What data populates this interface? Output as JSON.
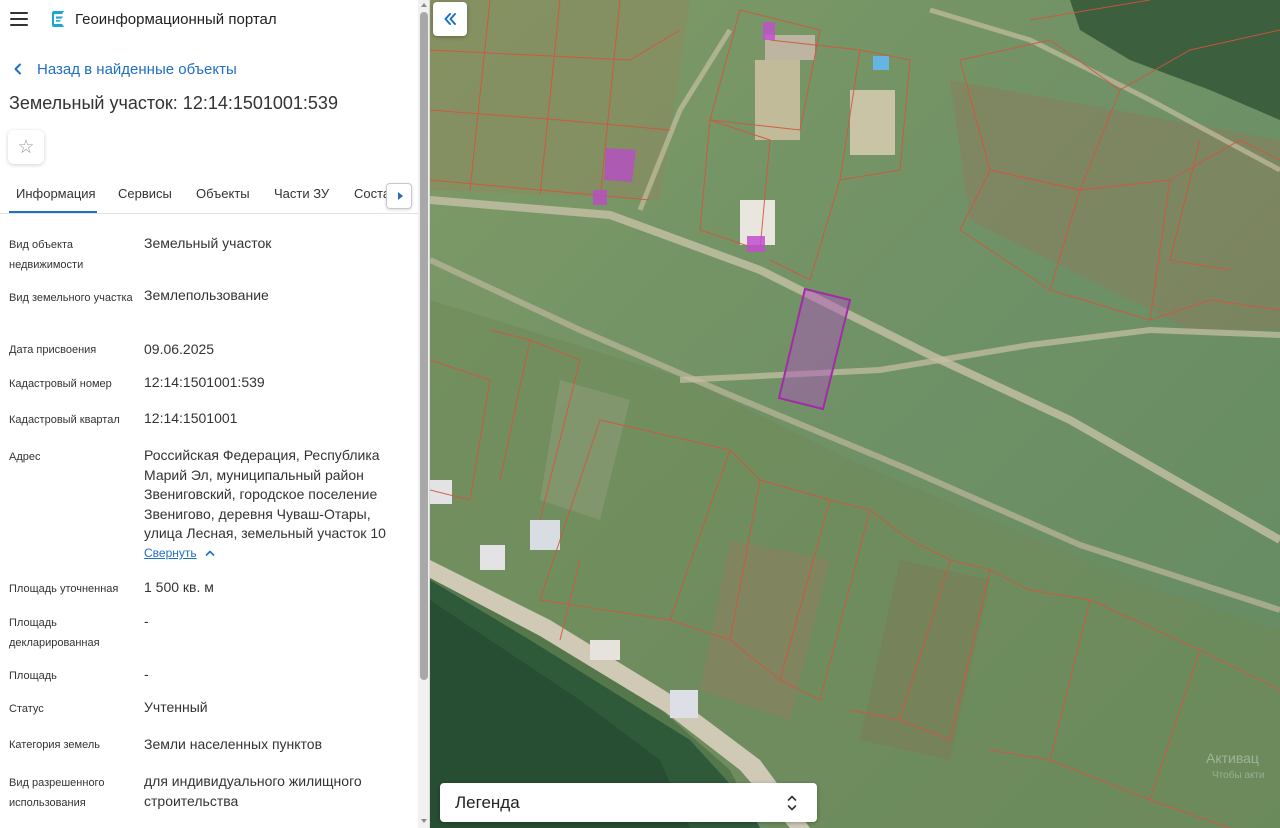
{
  "header": {
    "menu_icon": "hamburger-menu-icon",
    "logo_icon": "portal-logo-icon",
    "portal_title": "Геоинформационный портал"
  },
  "navigation": {
    "back_label": "Назад в найденные объекты"
  },
  "object": {
    "title": "Земельный участок: 12:14:1501001:539",
    "favorite_icon": "star-icon"
  },
  "tabs": [
    {
      "label": "Информация",
      "active": true
    },
    {
      "label": "Сервисы",
      "active": false
    },
    {
      "label": "Объекты",
      "active": false
    },
    {
      "label": "Части ЗУ",
      "active": false
    },
    {
      "label": "Соста",
      "active": false
    }
  ],
  "info": {
    "object_type": {
      "label": "Вид объекта недвижимости",
      "value": "Земельный участок"
    },
    "land_type": {
      "label": "Вид земельного участка",
      "value": "Землепользование"
    },
    "assign_date": {
      "label": "Дата присвоения",
      "value": "09.06.2025"
    },
    "cadastral_number": {
      "label": "Кадастровый номер",
      "value": "12:14:1501001:539"
    },
    "cadastral_quarter": {
      "label": "Кадастровый квартал",
      "value": "12:14:1501001"
    },
    "address": {
      "label": "Адрес",
      "value": "Российская Федерация, Республика Марий Эл, муниципальный район Звениговский, городское поселение Звенигово, деревня Чуваш-Отары, улица Лесная, земельный участок 10"
    },
    "collapse_label": "Свернуть",
    "area_refined": {
      "label": "Площадь уточненная",
      "value": "1 500 кв. м"
    },
    "area_declared": {
      "label": "Площадь декларированная",
      "value": "-"
    },
    "area": {
      "label": "Площадь",
      "value": "-"
    },
    "status": {
      "label": "Статус",
      "value": "Учтенный"
    },
    "land_category": {
      "label": "Категория земель",
      "value": "Земли населенных пунктов"
    },
    "permitted_use": {
      "label": "Вид разрешенного использования",
      "value": "для индивидуального жилищного строительства"
    }
  },
  "map": {
    "collapse_icon": "double-chevron-left-icon",
    "legend_label": "Легенда",
    "legend_icon": "up-down-chevron-icon",
    "watermark": "Активац",
    "watermark_sub": "Чтобы акти",
    "parcel_color": "#a22ca8",
    "boundary_color": "#d2553f"
  },
  "colors": {
    "accent": "#1f6fc4",
    "text": "#333333"
  }
}
